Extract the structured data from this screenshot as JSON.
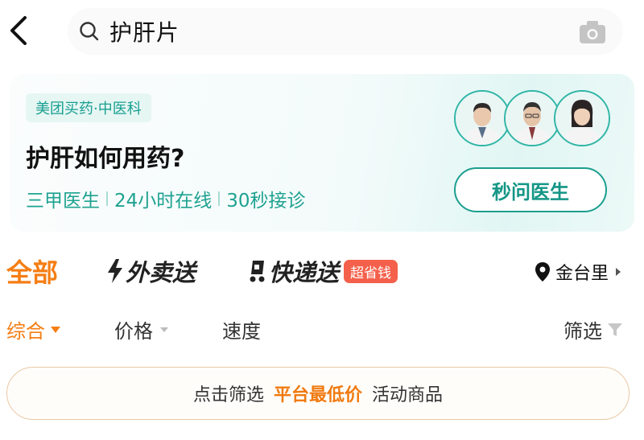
{
  "search": {
    "query": "护肝片"
  },
  "promo": {
    "tag": "美团买药·中医科",
    "title": "护肝如何用药?",
    "features": [
      "三甲医生",
      "24小时在线",
      "30秒接诊"
    ],
    "button": "秒问医生"
  },
  "tabs": {
    "all": "全部",
    "waimai": "外卖送",
    "kuaidi": "快递送",
    "kuaidi_badge": "超省钱",
    "location": "金台里"
  },
  "sort": {
    "zonghe": "综合",
    "price": "价格",
    "speed": "速度",
    "filter": "筛选"
  },
  "banner": {
    "prefix": "点击筛选",
    "highlight": "平台最低价",
    "suffix": "活动商品"
  },
  "colors": {
    "accent": "#f57e14",
    "teal": "#1ea291",
    "badge": "#f4604b"
  }
}
